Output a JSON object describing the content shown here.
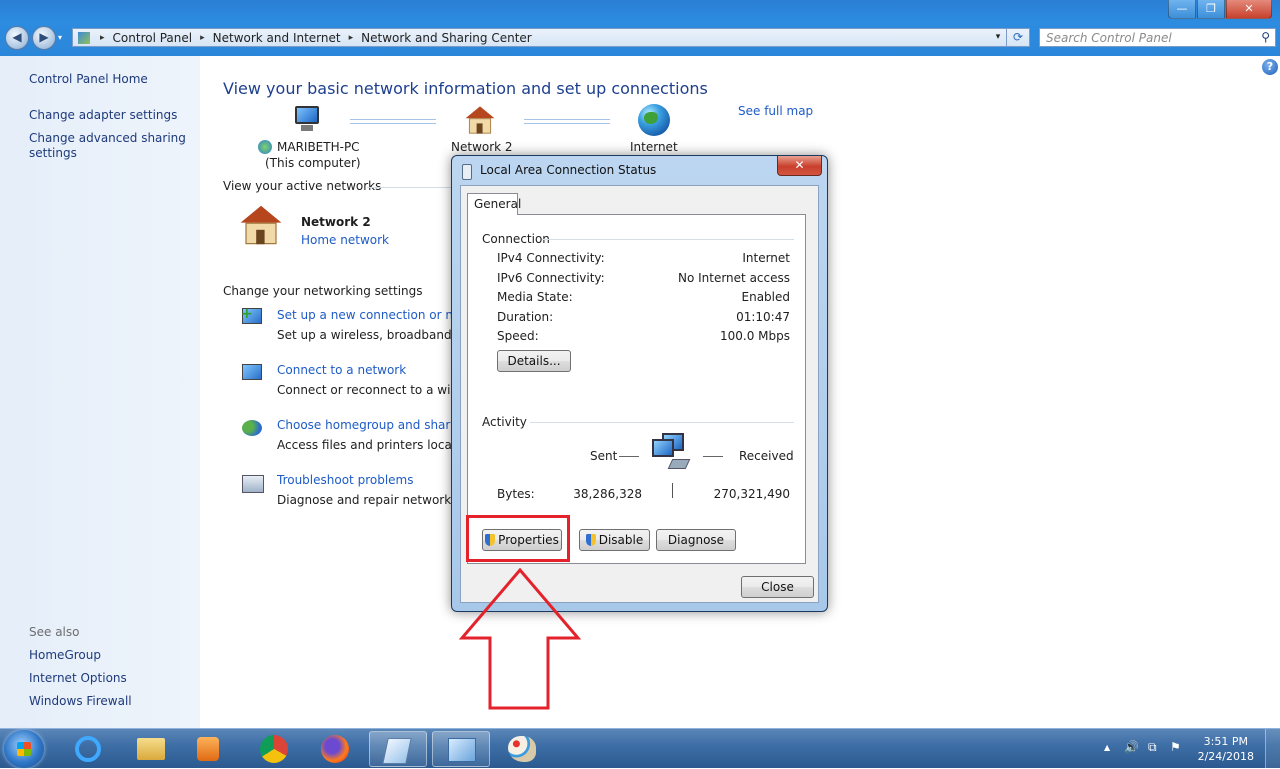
{
  "window": {
    "controls": {
      "minimize": "—",
      "maximize": "❐",
      "close": "✕"
    },
    "back_glyph": "◀",
    "forward_glyph": "▶"
  },
  "address_bar": {
    "crumbs": [
      "Control Panel",
      "Network and Internet",
      "Network and Sharing Center"
    ],
    "separator": "▸",
    "dropdown_glyph": "▾",
    "refresh_glyph": "⟳"
  },
  "search": {
    "placeholder": "Search Control Panel",
    "icon": "search-icon",
    "glyph": "⚲"
  },
  "left_pane": {
    "home": "Control Panel Home",
    "links": [
      "Change adapter settings",
      "Change advanced sharing",
      "settings"
    ],
    "see_also_label": "See also",
    "see_also": [
      "HomeGroup",
      "Internet Options",
      "Windows Firewall"
    ]
  },
  "main": {
    "help_glyph": "?",
    "heading": "View your basic network information and set up connections",
    "see_full_map": "See full map",
    "map": {
      "computer_name": "MARIBETH-PC",
      "computer_sub": "(This computer)",
      "network_name": "Network  2",
      "internet": "Internet"
    },
    "active_networks_title": "View your active networks",
    "active_network_name": "Network  2",
    "active_network_type": "Home network",
    "change_settings_title": "Change your networking settings",
    "tasks": [
      {
        "title": "Set up a new connection or netw",
        "desc": "Set up a wireless, broadband, dial"
      },
      {
        "title": "Connect to a network",
        "desc": "Connect or reconnect to a wirele"
      },
      {
        "title": "Choose homegroup and sharing",
        "desc": "Access files and printers located"
      },
      {
        "title": "Troubleshoot problems",
        "desc": "Diagnose and repair network prol"
      }
    ]
  },
  "dialog": {
    "title": "Local Area Connection Status",
    "close_glyph": "✕",
    "tab": "General",
    "connection_label": "Connection",
    "rows": [
      {
        "label": "IPv4 Connectivity:",
        "value": "Internet"
      },
      {
        "label": "IPv6 Connectivity:",
        "value": "No Internet access"
      },
      {
        "label": "Media State:",
        "value": "Enabled"
      },
      {
        "label": "Duration:",
        "value": "01:10:47"
      },
      {
        "label": "Speed:",
        "value": "100.0 Mbps"
      }
    ],
    "details_button": "Details...",
    "activity_label": "Activity",
    "sent_label": "Sent",
    "received_label": "Received",
    "bytes_label": "Bytes:",
    "bytes_sent": "38,286,328",
    "bytes_received": "270,321,490",
    "properties_button": "Properties",
    "disable_button": "Disable",
    "diagnose_button": "Diagnose",
    "close_button": "Close"
  },
  "annotation": {
    "color": "#e4222b"
  },
  "taskbar": {
    "apps": [
      "internet-explorer-icon",
      "file-explorer-icon",
      "media-player-icon",
      "chrome-icon",
      "firefox-icon",
      "notepad-icon",
      "control-panel-icon",
      "paint-icon"
    ],
    "tray_glyphs": {
      "up": "▲",
      "volume": "🔊",
      "network": "⧉",
      "flag": "⚑"
    },
    "time": "3:51 PM",
    "date": "2/24/2018"
  },
  "colors": {
    "link": "#1e5bc6",
    "heading": "#1e3f8f",
    "titlebar": "#2a86d9"
  }
}
